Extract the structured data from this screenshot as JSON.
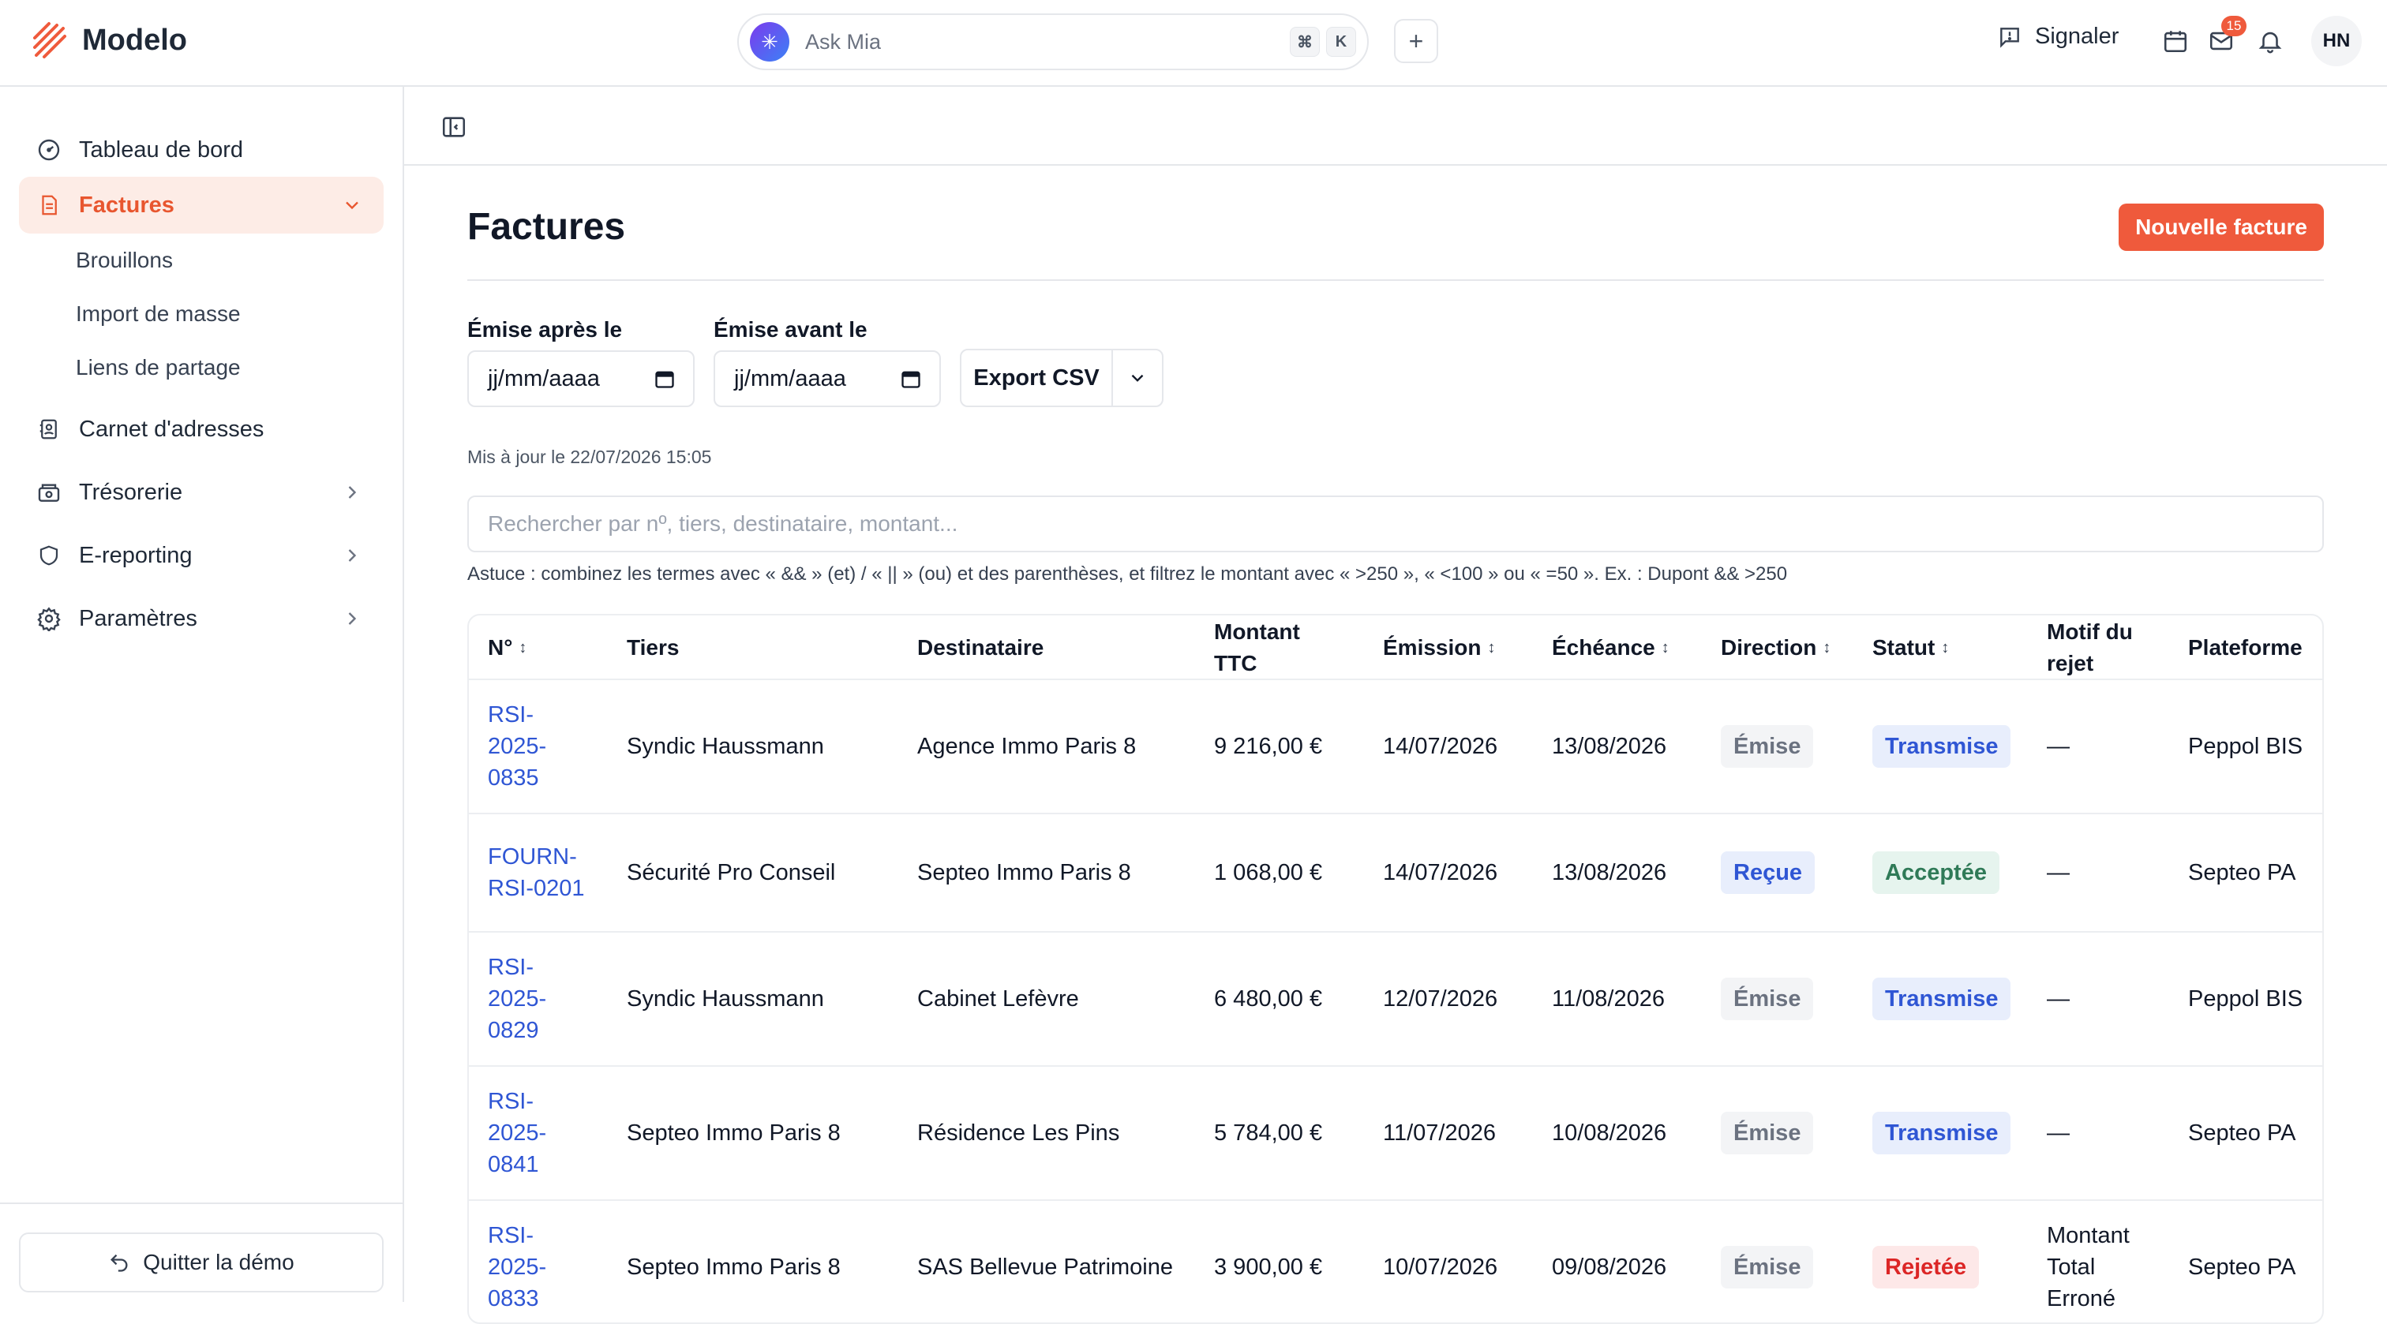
{
  "app": {
    "name": "Modelo"
  },
  "topbar": {
    "ask_placeholder": "Ask Mia",
    "kbd_cmd": "⌘",
    "kbd_k": "K",
    "plus": "+",
    "signal_label": "Signaler",
    "mail_badge": "15",
    "avatar_initials": "HN"
  },
  "sidebar": {
    "items": [
      {
        "label": "Tableau de bord",
        "icon": "dashboard-icon"
      },
      {
        "label": "Factures",
        "icon": "invoice-icon"
      },
      {
        "label": "Carnet d'adresses",
        "icon": "contacts-icon"
      },
      {
        "label": "Trésorerie",
        "icon": "treasury-icon"
      },
      {
        "label": "E-reporting",
        "icon": "shield-icon"
      },
      {
        "label": "Paramètres",
        "icon": "gear-icon"
      }
    ],
    "subitems": [
      "Brouillons",
      "Import de masse",
      "Liens de partage"
    ],
    "quit_label": "Quitter la démo"
  },
  "main": {
    "title": "Factures",
    "new_button": "Nouvelle facture",
    "filter_after_label": "Émise après le",
    "filter_before_label": "Émise avant le",
    "date_placeholder": "jj/mm/aaaa",
    "export_label": "Export CSV",
    "updated": "Mis à jour le 22/07/2026 15:05",
    "search_placeholder": "Rechercher par nº, tiers, destinataire, montant...",
    "hint": "Astuce : combinez les termes avec « && » (et) / « || » (ou) et des parenthèses, et filtrez le montant avec « >250 », « <100 » ou « =50 ». Ex. : Dupont && >250"
  },
  "table": {
    "headers": {
      "no": "N°",
      "tiers": "Tiers",
      "dest": "Destinataire",
      "montant": "Montant TTC",
      "emission": "Émission",
      "echeance": "Échéance",
      "direction": "Direction",
      "statut": "Statut",
      "motif": "Motif du rejet",
      "plateforme": "Plateforme"
    },
    "sort_glyph": "↕",
    "rows": [
      {
        "no": "RSI-2025-0835",
        "tiers": "Syndic Haussmann",
        "dest": "Agence Immo Paris 8",
        "montant": "9 216,00 €",
        "emission": "14/07/2026",
        "echeance": "13/08/2026",
        "direction": "Émise",
        "statut": "Transmise",
        "motif": "—",
        "plateforme": "Peppol BIS"
      },
      {
        "no": "FOURN-RSI-0201",
        "tiers": "Sécurité Pro Conseil",
        "dest": "Septeo Immo Paris 8",
        "montant": "1 068,00 €",
        "emission": "14/07/2026",
        "echeance": "13/08/2026",
        "direction": "Reçue",
        "statut": "Acceptée",
        "motif": "—",
        "plateforme": "Septeo PA"
      },
      {
        "no": "RSI-2025-0829",
        "tiers": "Syndic Haussmann",
        "dest": "Cabinet Lefèvre",
        "montant": "6 480,00 €",
        "emission": "12/07/2026",
        "echeance": "11/08/2026",
        "direction": "Émise",
        "statut": "Transmise",
        "motif": "—",
        "plateforme": "Peppol BIS"
      },
      {
        "no": "RSI-2025-0841",
        "tiers": "Septeo Immo Paris 8",
        "dest": "Résidence Les Pins",
        "montant": "5 784,00 €",
        "emission": "11/07/2026",
        "echeance": "10/08/2026",
        "direction": "Émise",
        "statut": "Transmise",
        "motif": "—",
        "plateforme": "Septeo PA"
      },
      {
        "no": "RSI-2025-0833",
        "tiers": "Septeo Immo Paris 8",
        "dest": "SAS Bellevue Patrimoine",
        "montant": "3 900,00 €",
        "emission": "10/07/2026",
        "echeance": "09/08/2026",
        "direction": "Émise",
        "statut": "Rejetée",
        "motif": "Montant Total Erroné",
        "plateforme": "Septeo PA"
      }
    ]
  },
  "colors": {
    "accent": "#ef5a3c",
    "link": "#2f56d4",
    "accepted": "#2f7a57",
    "rejected": "#dc2626"
  }
}
